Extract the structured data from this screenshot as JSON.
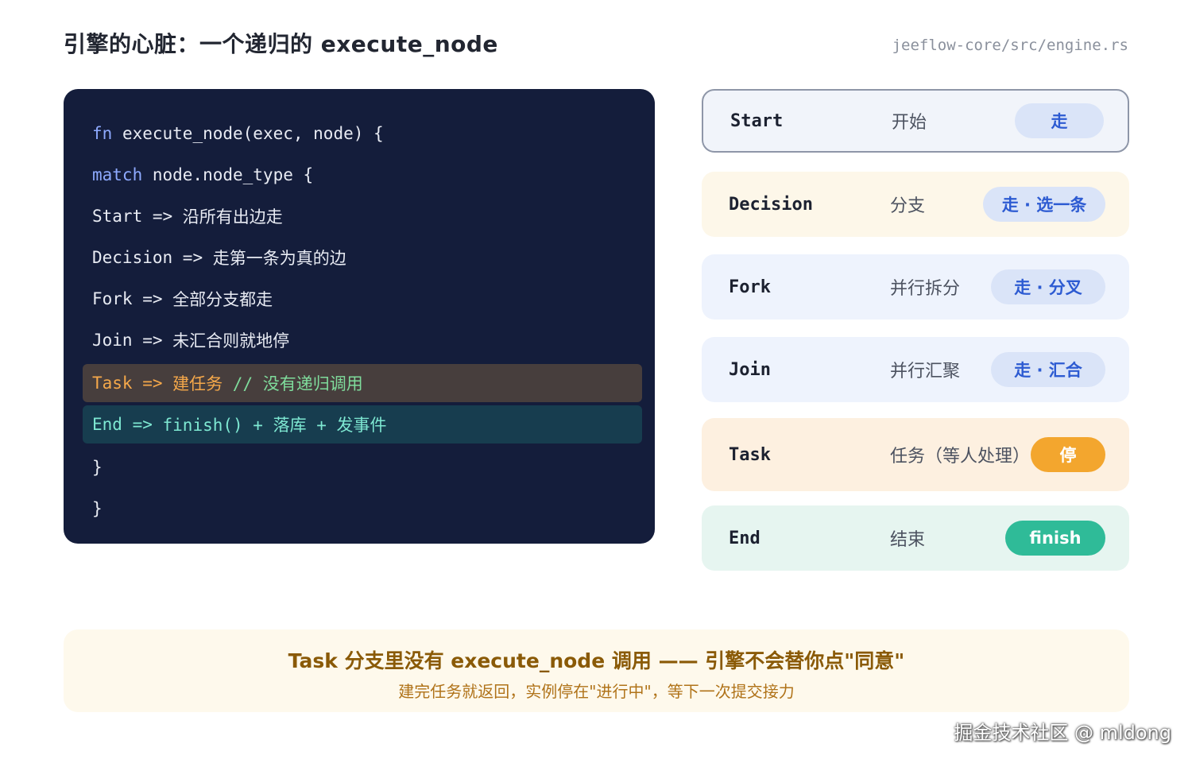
{
  "header": {
    "title": "引擎的心脏：一个递归的 execute_node",
    "source_path": "jeeflow-core/src/engine.rs"
  },
  "code": {
    "line1": {
      "keyword": "fn",
      "rest": " execute_node(exec, node) {"
    },
    "line2": {
      "keyword": "match",
      "rest": " node.node_type {"
    },
    "line3": {
      "name": "Start",
      "arrow": " => ",
      "text": "沿所有出边走"
    },
    "line4": {
      "name": "Decision",
      "arrow": " => ",
      "text": "走第一条为真的边"
    },
    "line5": {
      "name": "Fork",
      "arrow": " => ",
      "text": "全部分支都走"
    },
    "line6": {
      "name": "Join",
      "arrow": " => ",
      "text": "未汇合则就地停"
    },
    "line7": {
      "name": "Task",
      "arrow": " => ",
      "text": "建任务",
      "comment": " // 没有递归调用"
    },
    "line8": {
      "name": "End",
      "arrow": " => ",
      "text": "finish() + 落库 + 发事件"
    },
    "line9": "}",
    "line10": "}"
  },
  "nodes": [
    {
      "name": "Start",
      "desc": "开始",
      "badge": "走",
      "badge_color": "#dae4f8"
    },
    {
      "name": "Decision",
      "desc": "分支",
      "badge": "走 · 选一条",
      "badge_color": "#dae4f8"
    },
    {
      "name": "Fork",
      "desc": "并行拆分",
      "badge": "走 · 分叉",
      "badge_color": "#dae4f8"
    },
    {
      "name": "Join",
      "desc": "并行汇聚",
      "badge": "走 · 汇合",
      "badge_color": "#dae4f8"
    },
    {
      "name": "Task",
      "desc": "任务（等人处理）",
      "badge": "停",
      "badge_color": "#f3a62e"
    },
    {
      "name": "End",
      "desc": "结束",
      "badge": "finish",
      "badge_color": "#2fbb98"
    }
  ],
  "note": {
    "main": "Task 分支里没有 execute_node 调用 —— 引擎不会替你点\"同意\"",
    "sub": "建完任务就返回，实例停在\"进行中\"，等下一次提交接力"
  },
  "watermark": "掘金技术社区 @ mldong"
}
